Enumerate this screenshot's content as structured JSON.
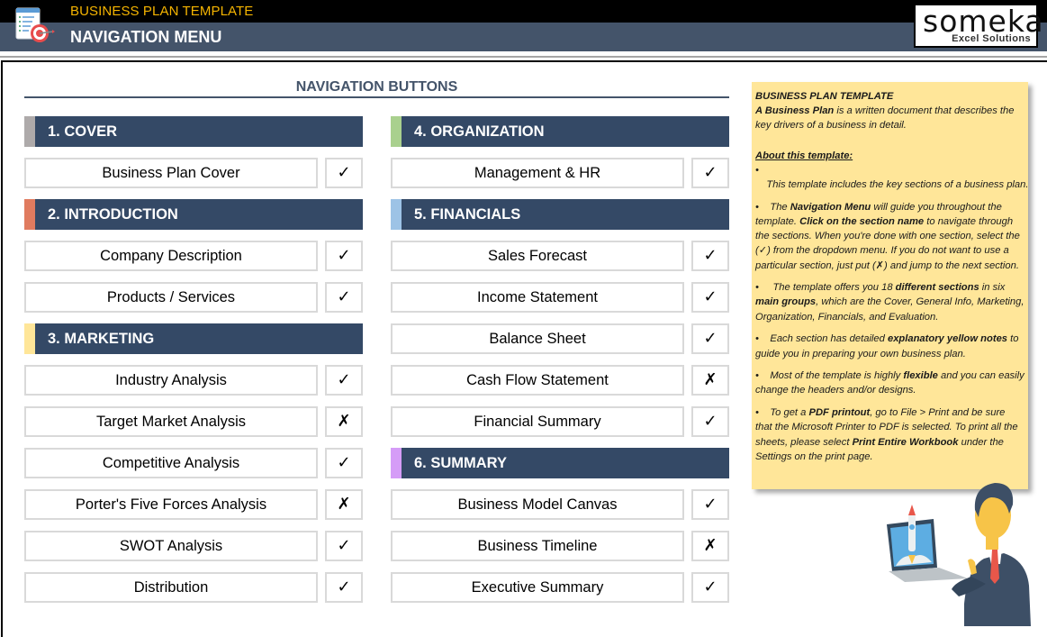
{
  "header": {
    "app_title": "BUSINESS PLAN TEMPLATE",
    "page_title": "NAVIGATION MENU",
    "logo": {
      "brand": "someka",
      "tagline": "Excel Solutions"
    }
  },
  "navigation": {
    "title": "NAVIGATION BUTTONS",
    "status_symbols": {
      "done": "✓",
      "skip": "✗"
    },
    "groups": [
      {
        "title": "1. COVER",
        "accent_color": "#aeaaaa",
        "items": [
          {
            "label": "Business Plan Cover",
            "status": "✓"
          }
        ]
      },
      {
        "title": "2. INTRODUCTION",
        "accent_color": "#e07b5f",
        "items": [
          {
            "label": "Company Description",
            "status": "✓"
          },
          {
            "label": "Products / Services",
            "status": "✓"
          }
        ]
      },
      {
        "title": "3. MARKETING",
        "accent_color": "#ffe699",
        "items": [
          {
            "label": "Industry Analysis",
            "status": "✓"
          },
          {
            "label": "Target Market Analysis",
            "status": "✗"
          },
          {
            "label": "Competitive Analysis",
            "status": "✓"
          },
          {
            "label": "Porter's Five Forces Analysis",
            "status": "✗"
          },
          {
            "label": "SWOT Analysis",
            "status": "✓"
          },
          {
            "label": "Distribution",
            "status": "✓"
          }
        ]
      },
      {
        "title": "4. ORGANIZATION",
        "accent_color": "#a9d08e",
        "items": [
          {
            "label": "Management & HR",
            "status": "✓"
          }
        ]
      },
      {
        "title": "5. FINANCIALS",
        "accent_color": "#9dc3e6",
        "items": [
          {
            "label": "Sales Forecast",
            "status": "✓"
          },
          {
            "label": "Income Statement",
            "status": "✓"
          },
          {
            "label": "Balance Sheet",
            "status": "✓"
          },
          {
            "label": "Cash Flow Statement",
            "status": "✗"
          },
          {
            "label": "Financial Summary",
            "status": "✓"
          }
        ]
      },
      {
        "title": "6. SUMMARY",
        "accent_color": "#d59cf7",
        "items": [
          {
            "label": "Business Model Canvas",
            "status": "✓"
          },
          {
            "label": "Business Timeline",
            "status": "✗"
          },
          {
            "label": "Executive Summary",
            "status": "✓"
          }
        ]
      }
    ]
  },
  "note": {
    "title": "BUSINESS PLAN TEMPLATE",
    "intro_bold": "A Business Plan",
    "intro_rest": " is a written document that describes the key drivers of a business in detail.",
    "about_heading": "About this template:",
    "bullet": "•",
    "b1": "    This template includes the key sections of a business plan.",
    "b2_a": "    The ",
    "b2_b": "Navigation Menu",
    "b2_c": " will guide you throughout the template. ",
    "b2_d": "Click on the section name",
    "b2_e": " to navigate through the sections. When you're done with one section, select the (✓) from the dropdown menu. If you do not want to use a particular section, just put (✗) and jump to the next section.",
    "b3_a": "     The template offers you 18 ",
    "b3_b": "different sections",
    "b3_c": " in six ",
    "b3_d": "main groups",
    "b3_e": ", which are the Cover, General Info, Marketing, Organization, Financials, and Evaluation.",
    "b4_a": "    Each section has detailed ",
    "b4_b": "explanatory yellow notes",
    "b4_c": " to guide you in preparing your own business plan.",
    "b5_a": "    Most of the template is highly ",
    "b5_b": "flexible",
    "b5_c": " and you can easily change the headers and/or designs.",
    "b6_a": "    To get a ",
    "b6_b": "PDF printout",
    "b6_c": ", go to File > Print and be sure that the Microsoft Printer to PDF is selected. To print all the sheets, please select ",
    "b6_d": "Print Entire Workbook",
    "b6_e": " under the Settings on the print page."
  }
}
